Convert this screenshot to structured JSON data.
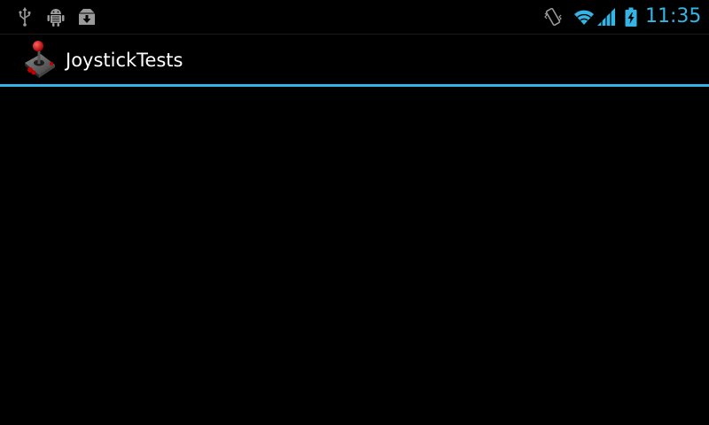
{
  "status_bar": {
    "time": "11:35",
    "left_icons": [
      "usb-icon",
      "debug-icon",
      "download-icon"
    ],
    "right_icons": [
      "vibrate-icon",
      "wifi-icon",
      "signal-icon",
      "battery-charging-icon"
    ],
    "accent_color": "#33b5e5"
  },
  "action_bar": {
    "title": "JoystickTests",
    "icon": "joystick-icon",
    "divider_color": "#33b5e5"
  }
}
